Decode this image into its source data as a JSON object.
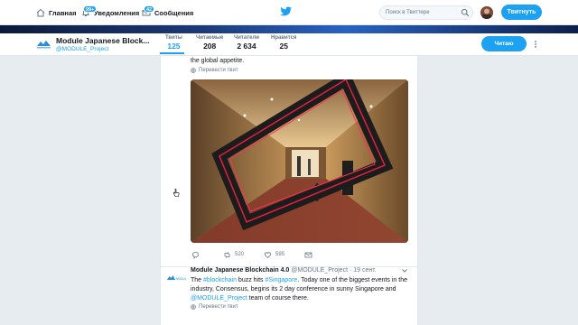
{
  "nav": {
    "home": "Главная",
    "notifications": "Уведомления",
    "notifications_badge": "99+",
    "messages": "Сообщения",
    "messages_badge": "42",
    "search_placeholder": "Поиск в Твиттере",
    "tweet_button": "Твитнуть"
  },
  "profile": {
    "name": "Module Japanese Block...",
    "handle": "@MODULE_Project",
    "follow_button": "Читаю",
    "stats": [
      {
        "label": "Твиты",
        "value": "125"
      },
      {
        "label": "Читаемые",
        "value": "208"
      },
      {
        "label": "Читатели",
        "value": "2 634"
      },
      {
        "label": "Нравится",
        "value": "25"
      }
    ]
  },
  "tweet1": {
    "text_tail": "the global appetite.",
    "translate": "Перевести твит",
    "retweets": "520",
    "likes": "595"
  },
  "tweet2": {
    "name": "Module Japanese Blockchain 4.0",
    "handle": "@MODULE_Project",
    "date": "· 19 сент.",
    "body_1": "The ",
    "hashtag_1": "#blockchain",
    "body_2": " buzz hits ",
    "hashtag_2": "#Singapore",
    "body_3": ". Today one of the biggest events in the industry, Consensus, begins its 2 day conference in sunny Singapore and ",
    "mention": "@MODULE_Project",
    "body_4": " team of course there.",
    "translate": "Перевести твит"
  },
  "colors": {
    "accent": "#1da1f2",
    "background": "#e6ecf0",
    "text": "#14171a",
    "muted": "#657786"
  }
}
